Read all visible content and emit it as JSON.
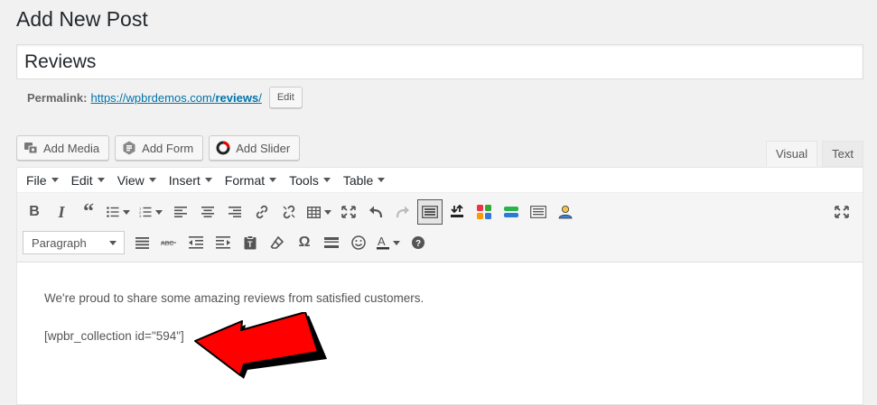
{
  "page": {
    "title": "Add New Post"
  },
  "post": {
    "title": "Reviews"
  },
  "permalink": {
    "label": "Permalink:",
    "url_prefix": "https://wpbrdemos.com/",
    "slug": "reviews",
    "url_suffix": "/",
    "edit_label": "Edit"
  },
  "media_buttons": [
    {
      "label": "Add Media",
      "icon": "media-icon"
    },
    {
      "label": "Add Form",
      "icon": "form-icon"
    },
    {
      "label": "Add Slider",
      "icon": "slider-icon"
    }
  ],
  "tabs": [
    {
      "label": "Visual",
      "active": true
    },
    {
      "label": "Text",
      "active": false
    }
  ],
  "menubar": [
    "File",
    "Edit",
    "View",
    "Insert",
    "Format",
    "Tools",
    "Table"
  ],
  "format_select": {
    "value": "Paragraph"
  },
  "content": {
    "paragraph": "We're proud to share some amazing reviews from satisfied customers.",
    "shortcode": "[wpbr_collection id=\"594\"]"
  },
  "colors": {
    "link": "#0073aa",
    "arrow_fill": "#ff0000",
    "arrow_outline": "#000000"
  }
}
